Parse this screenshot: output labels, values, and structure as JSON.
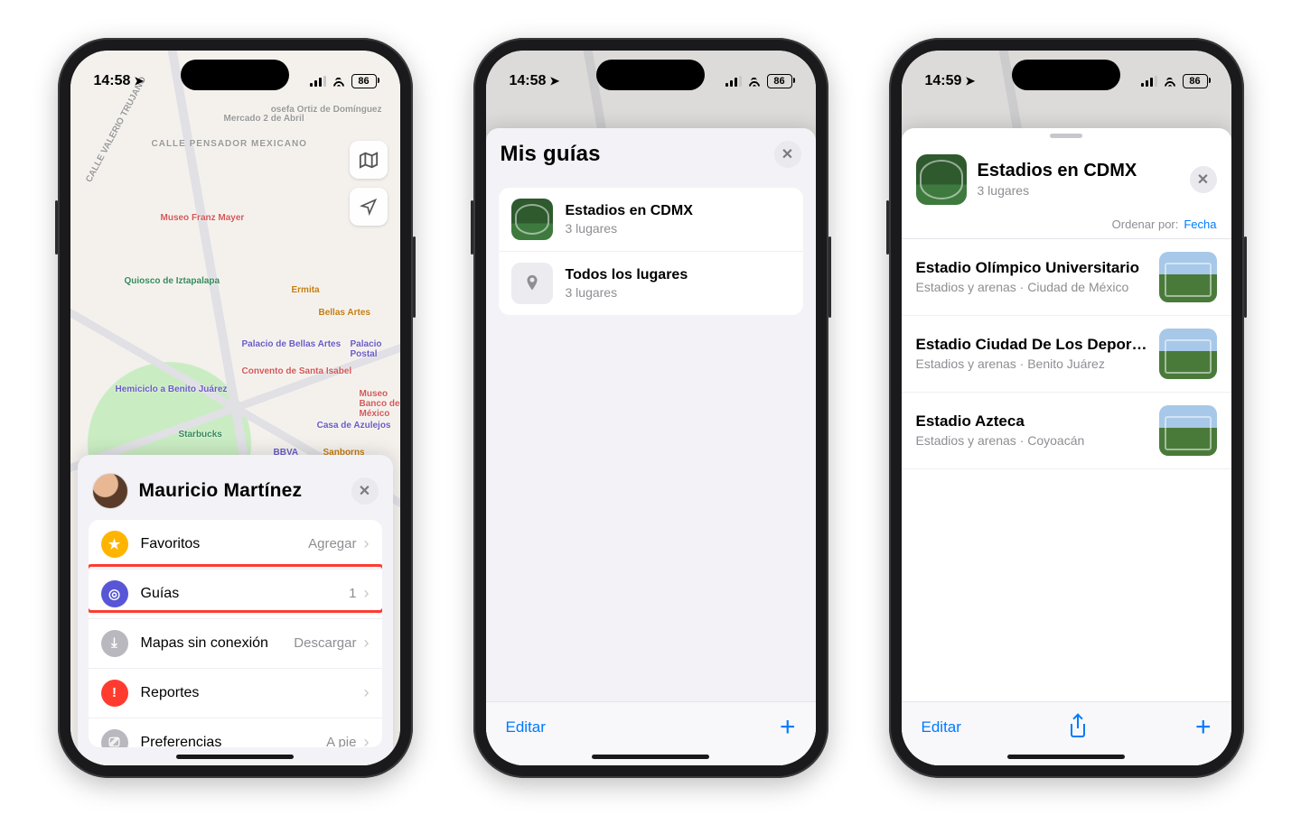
{
  "status": {
    "battery": "86"
  },
  "screen1": {
    "time": "14:58",
    "user_name": "Mauricio Martínez",
    "menu": {
      "favoritos": {
        "label": "Favoritos",
        "trail": "Agregar"
      },
      "guias": {
        "label": "Guías",
        "trail": "1"
      },
      "offline": {
        "label": "Mapas sin conexión",
        "trail": "Descargar"
      },
      "reportes": {
        "label": "Reportes"
      },
      "prefs": {
        "label": "Preferencias",
        "trail": "A pie"
      }
    },
    "map_labels": {
      "a": "Mercado 2 de Abril",
      "b": "CALLE PENSADOR MEXICANO",
      "c": "Museo Franz Mayer",
      "d": "Quiosco de Iztapalapa",
      "e": "Ermita",
      "f": "Bellas Artes",
      "g": "Palacio de Bellas Artes",
      "h": "Palacio Postal",
      "i": "Convento de Santa Isabel",
      "j": "Hemiciclo a Benito Juárez",
      "k": "Museo Banco de México",
      "l": "Starbucks",
      "m": "BBVA",
      "n": "Sanborns",
      "o": "Casa de Azulejos",
      "p": "osefa Ortiz de Domínguez",
      "q": "CALLE VALERIO TRUJANO"
    }
  },
  "screen2": {
    "time": "14:58",
    "title": "Mis guías",
    "items": [
      {
        "title": "Estadios en CDMX",
        "sub": "3 lugares"
      },
      {
        "title": "Todos los lugares",
        "sub": "3 lugares"
      }
    ],
    "edit": "Editar"
  },
  "screen3": {
    "time": "14:59",
    "title": "Estadios en CDMX",
    "sub": "3 lugares",
    "sort_label": "Ordenar por:",
    "sort_value": "Fecha",
    "places": [
      {
        "title": "Estadio Olímpico Universitario",
        "sub": "Estadios y arenas · Ciudad de México"
      },
      {
        "title": "Estadio Ciudad De Los Deport…",
        "sub": "Estadios y arenas · Benito Juárez"
      },
      {
        "title": "Estadio Azteca",
        "sub": "Estadios y arenas · Coyoacán"
      }
    ],
    "edit": "Editar"
  }
}
